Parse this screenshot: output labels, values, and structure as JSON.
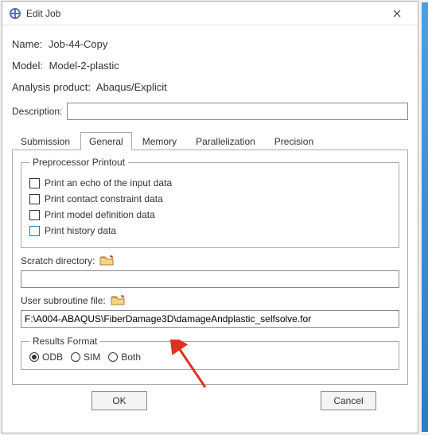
{
  "titlebar": {
    "title": "Edit Job"
  },
  "info": {
    "name_label": "Name:",
    "name_value": "Job-44-Copy",
    "model_label": "Model:",
    "model_value": "Model-2-plastic",
    "analysis_label": "Analysis product:",
    "analysis_value": "Abaqus/Explicit",
    "description_label": "Description:",
    "description_value": ""
  },
  "tabs": {
    "items": [
      {
        "label": "Submission"
      },
      {
        "label": "General"
      },
      {
        "label": "Memory"
      },
      {
        "label": "Parallelization"
      },
      {
        "label": "Precision"
      }
    ],
    "active_index": 1
  },
  "preprocessor": {
    "legend": "Preprocessor Printout",
    "checks": [
      {
        "label": "Print an echo of the input data"
      },
      {
        "label": "Print contact constraint data"
      },
      {
        "label": "Print model definition data"
      },
      {
        "label": "Print history data"
      }
    ]
  },
  "scratch": {
    "label": "Scratch directory:",
    "value": ""
  },
  "subroutine": {
    "label": "User subroutine file:",
    "value": "F:\\A004-ABAQUS\\FiberDamage3D\\damageAndplastic_selfsolve.for"
  },
  "results": {
    "legend": "Results Format",
    "options": [
      {
        "label": "ODB"
      },
      {
        "label": "SIM"
      },
      {
        "label": "Both"
      }
    ],
    "selected_index": 0
  },
  "buttons": {
    "ok": "OK",
    "cancel": "Cancel"
  }
}
